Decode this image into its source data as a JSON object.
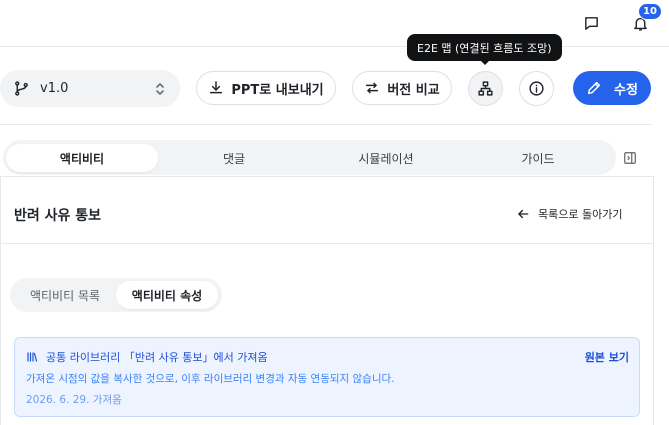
{
  "header": {
    "notification_count": "10",
    "icons": [
      "chat-icon",
      "bell-icon"
    ]
  },
  "tooltip": {
    "text": "E2E 맵 (연결된 흐름도 조망)"
  },
  "toolbar": {
    "version": "v1.0",
    "export_label": "PPT로 내보내기",
    "compare_label": "버전 비교",
    "edit_label": "수정"
  },
  "tabs": [
    {
      "label": "액티비티",
      "active": true
    },
    {
      "label": "댓글",
      "active": false
    },
    {
      "label": "시뮬레이션",
      "active": false
    },
    {
      "label": "가이드",
      "active": false
    }
  ],
  "page": {
    "title": "반려 사유 통보",
    "back_label": "목록으로 돌아가기"
  },
  "subtabs": [
    {
      "label": "액티비티 목록",
      "active": false
    },
    {
      "label": "액티비티 속성",
      "active": true
    }
  ],
  "info": {
    "title": "공통 라이브러리 「반려 사유 통보」에서 가져옴",
    "description": "가져온 시점의 값을 복사한 것으로, 이후 라이브러리 변경과 자동 연동되지 않습니다.",
    "date": "2026. 6. 29. 가져옴",
    "original_link": "원본 보기"
  },
  "colors": {
    "primary": "#2563eb",
    "tooltip_bg": "#111214",
    "info_bg": "#eef4ff"
  }
}
